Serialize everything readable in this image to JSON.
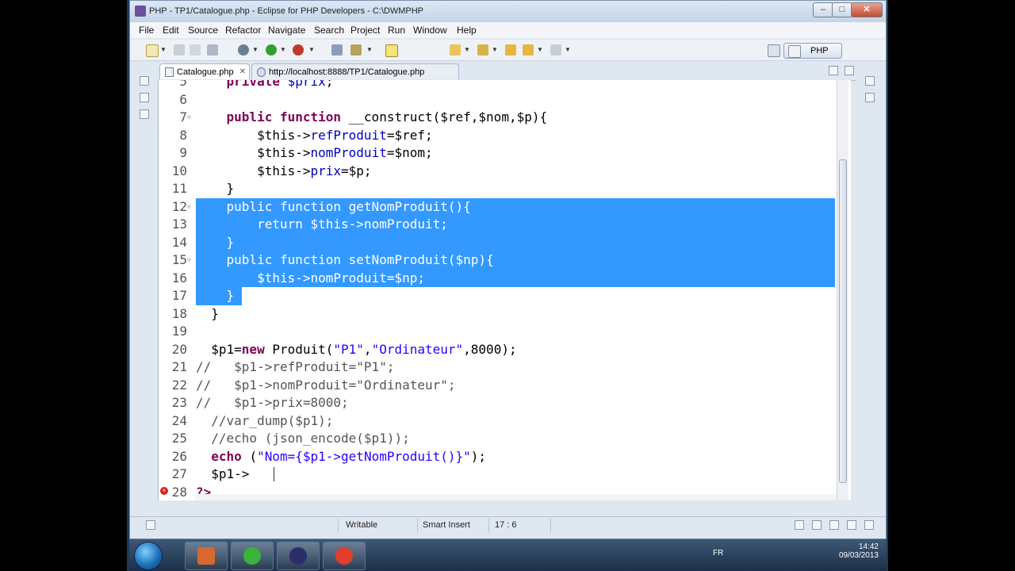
{
  "window": {
    "title": "PHP - TP1/Catalogue.php - Eclipse for PHP Developers - C:\\DWMPHP",
    "controls": {
      "minimize": "–",
      "maximize": "□",
      "close": "✕"
    }
  },
  "menu": [
    "File",
    "Edit",
    "Source",
    "Refactor",
    "Navigate",
    "Search",
    "Project",
    "Run",
    "Window",
    "Help"
  ],
  "perspective": {
    "label": "PHP"
  },
  "tabs": [
    {
      "label": "Catalogue.php",
      "close": "✕",
      "active": true
    },
    {
      "label": "http://localhost:8888/TP1/Catalogue.php",
      "active": false
    }
  ],
  "code_lines": [
    {
      "num": "5",
      "parts": [
        [
          "kw",
          "    private "
        ],
        [
          "fld",
          "$prix"
        ],
        [
          "plain",
          ";"
        ]
      ]
    },
    {
      "num": "6",
      "parts": []
    },
    {
      "num": "7",
      "fold": "⊖",
      "parts": [
        [
          "kw",
          "    public function "
        ],
        [
          "plain",
          "__construct($ref,$nom,$p){"
        ]
      ]
    },
    {
      "num": "8",
      "parts": [
        [
          "plain",
          "        $this->"
        ],
        [
          "fld",
          "refProduit"
        ],
        [
          "plain",
          "=$ref;"
        ]
      ]
    },
    {
      "num": "9",
      "parts": [
        [
          "plain",
          "        $this->"
        ],
        [
          "fld",
          "nomProduit"
        ],
        [
          "plain",
          "=$nom;"
        ]
      ]
    },
    {
      "num": "10",
      "parts": [
        [
          "plain",
          "        $this->"
        ],
        [
          "fld",
          "prix"
        ],
        [
          "plain",
          "=$p;"
        ]
      ]
    },
    {
      "num": "11",
      "parts": [
        [
          "plain",
          "    }"
        ]
      ]
    },
    {
      "num": "12",
      "fold": "⊖",
      "selected": true,
      "parts": [
        [
          "kw",
          "    public function "
        ],
        [
          "plain",
          "getNomProduit(){"
        ]
      ]
    },
    {
      "num": "13",
      "selected": true,
      "parts": [
        [
          "kw",
          "        return "
        ],
        [
          "plain",
          "$this->"
        ],
        [
          "fld",
          "nomProduit"
        ],
        [
          "plain",
          ";"
        ]
      ]
    },
    {
      "num": "14",
      "selected": true,
      "parts": [
        [
          "plain",
          "    }"
        ]
      ]
    },
    {
      "num": "15",
      "fold": "⊖",
      "selected": true,
      "parts": [
        [
          "kw",
          "    public function "
        ],
        [
          "plain",
          "setNomProduit($np){"
        ]
      ]
    },
    {
      "num": "16",
      "selected": true,
      "parts": [
        [
          "plain",
          "        $this->"
        ],
        [
          "fld",
          "nomProduit"
        ],
        [
          "plain",
          "=$np;"
        ]
      ]
    },
    {
      "num": "17",
      "selected": true,
      "partial": true,
      "parts": [
        [
          "plain",
          "    }"
        ]
      ]
    },
    {
      "num": "18",
      "parts": [
        [
          "plain",
          "  }"
        ]
      ]
    },
    {
      "num": "19",
      "parts": []
    },
    {
      "num": "20",
      "parts": [
        [
          "plain",
          "  $p1="
        ],
        [
          "kw",
          "new "
        ],
        [
          "plain",
          "Produit("
        ],
        [
          "str",
          "\"P1\""
        ],
        [
          "plain",
          ","
        ],
        [
          "str",
          "\"Ordinateur\""
        ],
        [
          "plain",
          ",8000);"
        ]
      ]
    },
    {
      "num": "21",
      "parts": [
        [
          "cmt",
          "//   $p1->refProduit=\"P1\";"
        ]
      ]
    },
    {
      "num": "22",
      "parts": [
        [
          "cmt",
          "//   $p1->nomProduit=\"Ordinateur\";"
        ]
      ]
    },
    {
      "num": "23",
      "parts": [
        [
          "cmt",
          "//   $p1->prix=8000;"
        ]
      ]
    },
    {
      "num": "24",
      "parts": [
        [
          "cmt",
          "  //var_dump($p1);"
        ]
      ]
    },
    {
      "num": "25",
      "parts": [
        [
          "cmt",
          "  //echo (json_encode($p1));"
        ]
      ]
    },
    {
      "num": "26",
      "parts": [
        [
          "kw",
          "  echo "
        ],
        [
          "plain",
          "("
        ],
        [
          "str",
          "\"Nom={$p1->getNomProduit()}\""
        ],
        [
          "plain",
          ");"
        ]
      ]
    },
    {
      "num": "27",
      "parts": [
        [
          "plain",
          "  $p1-> "
        ]
      ]
    },
    {
      "num": "28",
      "error": true,
      "parts": [
        [
          "err",
          "?>"
        ]
      ]
    }
  ],
  "status": {
    "writable": "Writable",
    "insert_mode": "Smart Insert",
    "position": "17 : 6"
  },
  "taskbar": {
    "apps": [
      {
        "name": "presentation-app-icon",
        "color": "#d9682e"
      },
      {
        "name": "green-app-icon",
        "color": "#3bb33b"
      },
      {
        "name": "eclipse-app-icon",
        "color": "#2c2d6b"
      },
      {
        "name": "chrome-app-icon",
        "color": "#e0402b"
      }
    ],
    "tray": {
      "lang": "FR",
      "time": "14:42",
      "date": "09/03/2013"
    }
  }
}
